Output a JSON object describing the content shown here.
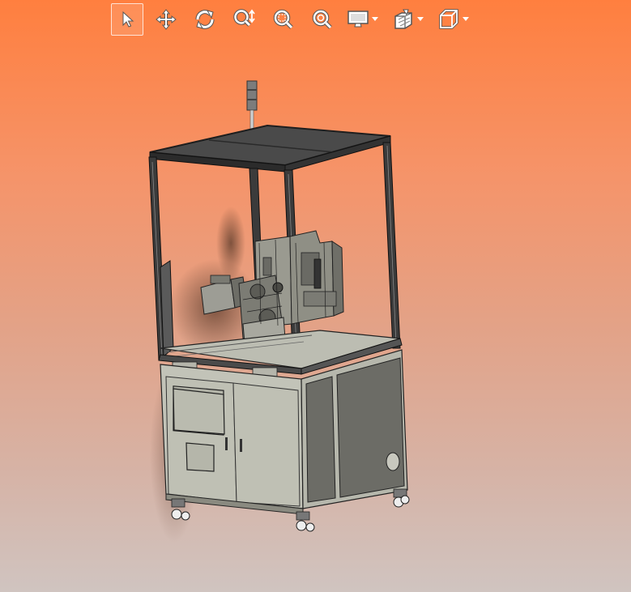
{
  "toolbar": {
    "buttons": [
      {
        "icon": "select-pointer-icon",
        "active": true
      },
      {
        "icon": "pan-move-icon",
        "active": false
      },
      {
        "icon": "rotate-icon",
        "active": false
      },
      {
        "icon": "zoom-dynamic-icon",
        "active": false
      },
      {
        "icon": "zoom-window-icon",
        "active": false
      },
      {
        "icon": "zoom-fit-icon",
        "active": false
      },
      {
        "icon": "display-mode-icon",
        "dropdown": true
      },
      {
        "icon": "section-view-icon",
        "dropdown": true
      },
      {
        "icon": "view-orientation-cube-icon",
        "dropdown": true
      }
    ]
  },
  "viewport": {
    "background_top": "#ff7f3f",
    "background_bottom": "#d0c4c0",
    "model": "industrial-machine-cabinet-3d-model"
  }
}
